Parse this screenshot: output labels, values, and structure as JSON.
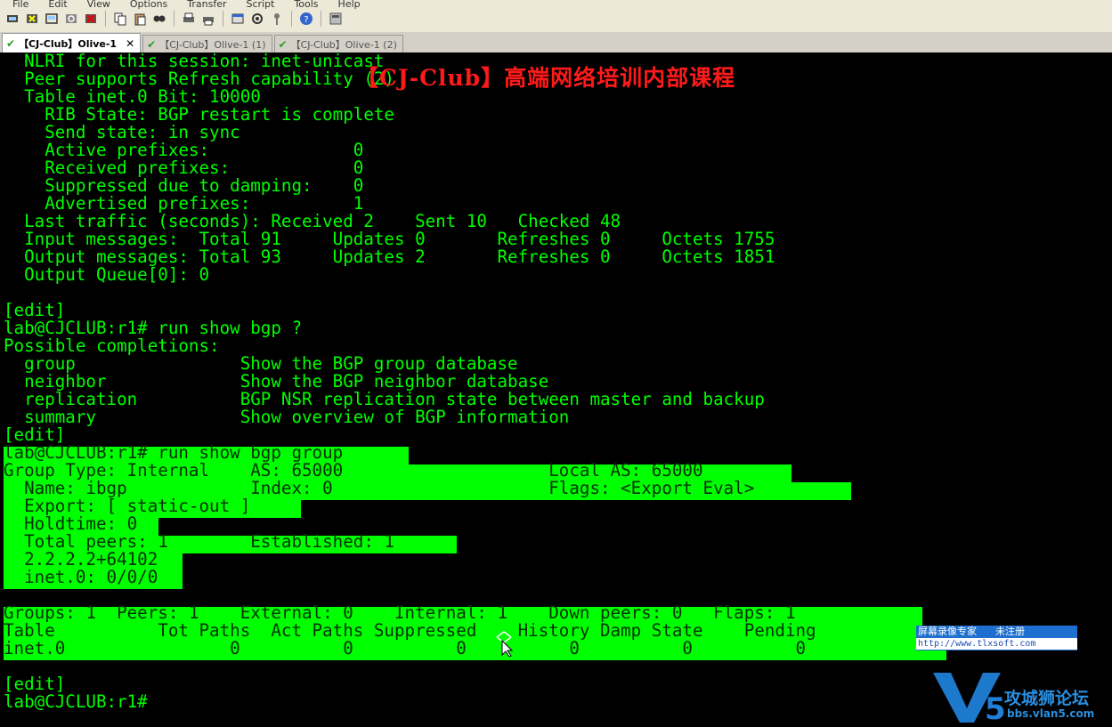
{
  "menu": [
    "File",
    "Edit",
    "View",
    "Options",
    "Transfer",
    "Script",
    "Tools",
    "Help"
  ],
  "toolbar_icons": [
    "connect-icon",
    "quick-connect-icon",
    "connect-tab-icon",
    "reconnect-icon",
    "disconnect-icon",
    "copy-icon",
    "paste-icon",
    "find-icon",
    "print-setup-icon",
    "print-icon",
    "session-options-icon",
    "global-options-icon",
    "keymap-icon",
    "help-icon",
    "about-icon"
  ],
  "tabs": [
    {
      "label": "【CJ-Club】Olive-1",
      "active": true
    },
    {
      "label": "【CJ-Club】Olive-1 (1)",
      "active": false
    },
    {
      "label": "【CJ-Club】Olive-1 (2)",
      "active": false
    }
  ],
  "terminal": {
    "lines": [
      "  NLRI for this session: inet-unicast",
      "  Peer supports Refresh capability (2)",
      "  Table inet.0 Bit: 10000",
      "    RIB State: BGP restart is complete",
      "    Send state: in sync",
      "    Active prefixes:              0",
      "    Received prefixes:            0",
      "    Suppressed due to damping:    0",
      "    Advertised prefixes:          1",
      "  Last traffic (seconds): Received 2    Sent 10   Checked 48",
      "  Input messages:  Total 91     Updates 0       Refreshes 0     Octets 1755",
      "  Output messages: Total 93     Updates 2       Refreshes 0     Octets 1851",
      "  Output Queue[0]: 0",
      "",
      "[edit]",
      "lab@CJCLUB:r1# run show bgp ?",
      "Possible completions:",
      "  group                Show the BGP group database",
      "  neighbor             Show the BGP neighbor database",
      "  replication          BGP NSR replication state between master and backup",
      "  summary              Show overview of BGP information",
      "[edit]",
      "lab@CJCLUB:r1# run show bgp group",
      "Group Type: Internal    AS: 65000                    Local AS: 65000",
      "  Name: ibgp            Index: 0                     Flags: <Export Eval>",
      "  Export: [ static-out ]",
      "  Holdtime: 0",
      "  Total peers: 1        Established: 1",
      "  2.2.2.2+64102",
      "  inet.0: 0/0/0",
      "",
      "Groups: 1  Peers: 1    External: 0    Internal: 1    Down peers: 0   Flaps: 1",
      "Table          Tot Paths  Act Paths Suppressed    History Damp State    Pending",
      "inet.0                0          0          0          0          0          0",
      "",
      "[edit]",
      "lab@CJCLUB:r1# "
    ]
  },
  "overlays": {
    "course_title": "【CJ-Club】高端网络培训内部课程",
    "recorder_name": "屏幕录像专家",
    "recorder_status": "未注册",
    "recorder_url": "http://www.tlxsoft.com",
    "forum_name": "攻城狮论坛",
    "forum_url": "bbs.vlan5.com"
  },
  "colors": {
    "terminal_bg": "#000000",
    "terminal_fg": "#00ff00",
    "highlight_bg": "#00ff00",
    "watermark": "#ff1a1a"
  }
}
